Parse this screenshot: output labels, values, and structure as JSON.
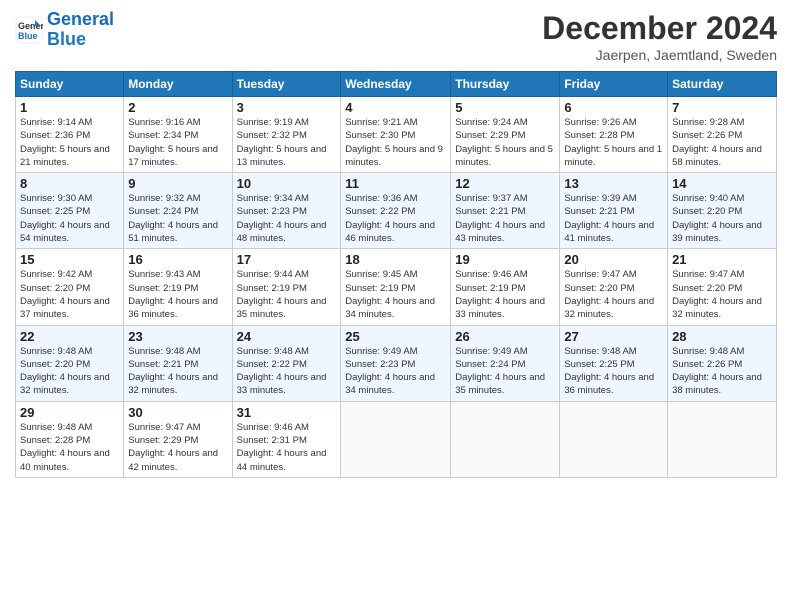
{
  "header": {
    "logo_line1": "General",
    "logo_line2": "Blue",
    "month": "December 2024",
    "location": "Jaerpen, Jaemtland, Sweden"
  },
  "weekdays": [
    "Sunday",
    "Monday",
    "Tuesday",
    "Wednesday",
    "Thursday",
    "Friday",
    "Saturday"
  ],
  "weeks": [
    [
      {
        "day": "1",
        "sunrise": "Sunrise: 9:14 AM",
        "sunset": "Sunset: 2:36 PM",
        "daylight": "Daylight: 5 hours and 21 minutes."
      },
      {
        "day": "2",
        "sunrise": "Sunrise: 9:16 AM",
        "sunset": "Sunset: 2:34 PM",
        "daylight": "Daylight: 5 hours and 17 minutes."
      },
      {
        "day": "3",
        "sunrise": "Sunrise: 9:19 AM",
        "sunset": "Sunset: 2:32 PM",
        "daylight": "Daylight: 5 hours and 13 minutes."
      },
      {
        "day": "4",
        "sunrise": "Sunrise: 9:21 AM",
        "sunset": "Sunset: 2:30 PM",
        "daylight": "Daylight: 5 hours and 9 minutes."
      },
      {
        "day": "5",
        "sunrise": "Sunrise: 9:24 AM",
        "sunset": "Sunset: 2:29 PM",
        "daylight": "Daylight: 5 hours and 5 minutes."
      },
      {
        "day": "6",
        "sunrise": "Sunrise: 9:26 AM",
        "sunset": "Sunset: 2:28 PM",
        "daylight": "Daylight: 5 hours and 1 minute."
      },
      {
        "day": "7",
        "sunrise": "Sunrise: 9:28 AM",
        "sunset": "Sunset: 2:26 PM",
        "daylight": "Daylight: 4 hours and 58 minutes."
      }
    ],
    [
      {
        "day": "8",
        "sunrise": "Sunrise: 9:30 AM",
        "sunset": "Sunset: 2:25 PM",
        "daylight": "Daylight: 4 hours and 54 minutes."
      },
      {
        "day": "9",
        "sunrise": "Sunrise: 9:32 AM",
        "sunset": "Sunset: 2:24 PM",
        "daylight": "Daylight: 4 hours and 51 minutes."
      },
      {
        "day": "10",
        "sunrise": "Sunrise: 9:34 AM",
        "sunset": "Sunset: 2:23 PM",
        "daylight": "Daylight: 4 hours and 48 minutes."
      },
      {
        "day": "11",
        "sunrise": "Sunrise: 9:36 AM",
        "sunset": "Sunset: 2:22 PM",
        "daylight": "Daylight: 4 hours and 46 minutes."
      },
      {
        "day": "12",
        "sunrise": "Sunrise: 9:37 AM",
        "sunset": "Sunset: 2:21 PM",
        "daylight": "Daylight: 4 hours and 43 minutes."
      },
      {
        "day": "13",
        "sunrise": "Sunrise: 9:39 AM",
        "sunset": "Sunset: 2:21 PM",
        "daylight": "Daylight: 4 hours and 41 minutes."
      },
      {
        "day": "14",
        "sunrise": "Sunrise: 9:40 AM",
        "sunset": "Sunset: 2:20 PM",
        "daylight": "Daylight: 4 hours and 39 minutes."
      }
    ],
    [
      {
        "day": "15",
        "sunrise": "Sunrise: 9:42 AM",
        "sunset": "Sunset: 2:20 PM",
        "daylight": "Daylight: 4 hours and 37 minutes."
      },
      {
        "day": "16",
        "sunrise": "Sunrise: 9:43 AM",
        "sunset": "Sunset: 2:19 PM",
        "daylight": "Daylight: 4 hours and 36 minutes."
      },
      {
        "day": "17",
        "sunrise": "Sunrise: 9:44 AM",
        "sunset": "Sunset: 2:19 PM",
        "daylight": "Daylight: 4 hours and 35 minutes."
      },
      {
        "day": "18",
        "sunrise": "Sunrise: 9:45 AM",
        "sunset": "Sunset: 2:19 PM",
        "daylight": "Daylight: 4 hours and 34 minutes."
      },
      {
        "day": "19",
        "sunrise": "Sunrise: 9:46 AM",
        "sunset": "Sunset: 2:19 PM",
        "daylight": "Daylight: 4 hours and 33 minutes."
      },
      {
        "day": "20",
        "sunrise": "Sunrise: 9:47 AM",
        "sunset": "Sunset: 2:20 PM",
        "daylight": "Daylight: 4 hours and 32 minutes."
      },
      {
        "day": "21",
        "sunrise": "Sunrise: 9:47 AM",
        "sunset": "Sunset: 2:20 PM",
        "daylight": "Daylight: 4 hours and 32 minutes."
      }
    ],
    [
      {
        "day": "22",
        "sunrise": "Sunrise: 9:48 AM",
        "sunset": "Sunset: 2:20 PM",
        "daylight": "Daylight: 4 hours and 32 minutes."
      },
      {
        "day": "23",
        "sunrise": "Sunrise: 9:48 AM",
        "sunset": "Sunset: 2:21 PM",
        "daylight": "Daylight: 4 hours and 32 minutes."
      },
      {
        "day": "24",
        "sunrise": "Sunrise: 9:48 AM",
        "sunset": "Sunset: 2:22 PM",
        "daylight": "Daylight: 4 hours and 33 minutes."
      },
      {
        "day": "25",
        "sunrise": "Sunrise: 9:49 AM",
        "sunset": "Sunset: 2:23 PM",
        "daylight": "Daylight: 4 hours and 34 minutes."
      },
      {
        "day": "26",
        "sunrise": "Sunrise: 9:49 AM",
        "sunset": "Sunset: 2:24 PM",
        "daylight": "Daylight: 4 hours and 35 minutes."
      },
      {
        "day": "27",
        "sunrise": "Sunrise: 9:48 AM",
        "sunset": "Sunset: 2:25 PM",
        "daylight": "Daylight: 4 hours and 36 minutes."
      },
      {
        "day": "28",
        "sunrise": "Sunrise: 9:48 AM",
        "sunset": "Sunset: 2:26 PM",
        "daylight": "Daylight: 4 hours and 38 minutes."
      }
    ],
    [
      {
        "day": "29",
        "sunrise": "Sunrise: 9:48 AM",
        "sunset": "Sunset: 2:28 PM",
        "daylight": "Daylight: 4 hours and 40 minutes."
      },
      {
        "day": "30",
        "sunrise": "Sunrise: 9:47 AM",
        "sunset": "Sunset: 2:29 PM",
        "daylight": "Daylight: 4 hours and 42 minutes."
      },
      {
        "day": "31",
        "sunrise": "Sunrise: 9:46 AM",
        "sunset": "Sunset: 2:31 PM",
        "daylight": "Daylight: 4 hours and 44 minutes."
      },
      null,
      null,
      null,
      null
    ]
  ]
}
